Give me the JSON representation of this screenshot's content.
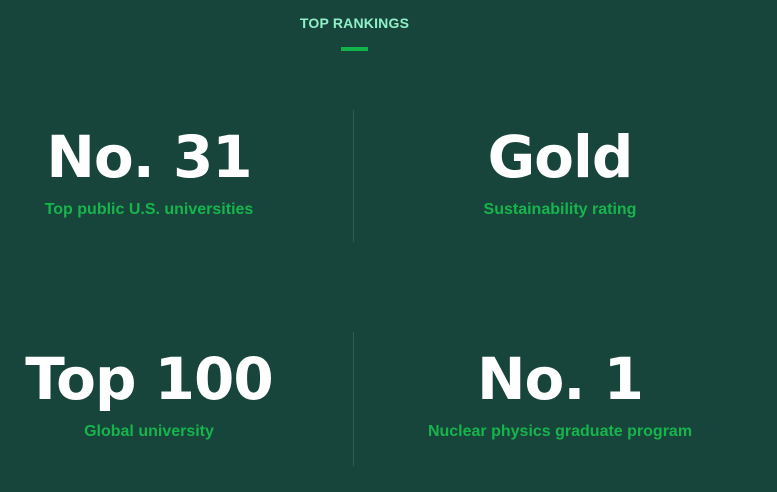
{
  "section": {
    "title": "TOP RANKINGS",
    "accent_color": "#12b24a",
    "title_color": "#8ff0c8",
    "background_color": "#18453b"
  },
  "stats": [
    {
      "value": "No. 31",
      "label": "Top public U.S. universities"
    },
    {
      "value": "Gold",
      "label": "Sustainability rating"
    },
    {
      "value": "Top 100",
      "label": "Global university"
    },
    {
      "value": "No. 1",
      "label": "Nuclear physics graduate program"
    }
  ]
}
